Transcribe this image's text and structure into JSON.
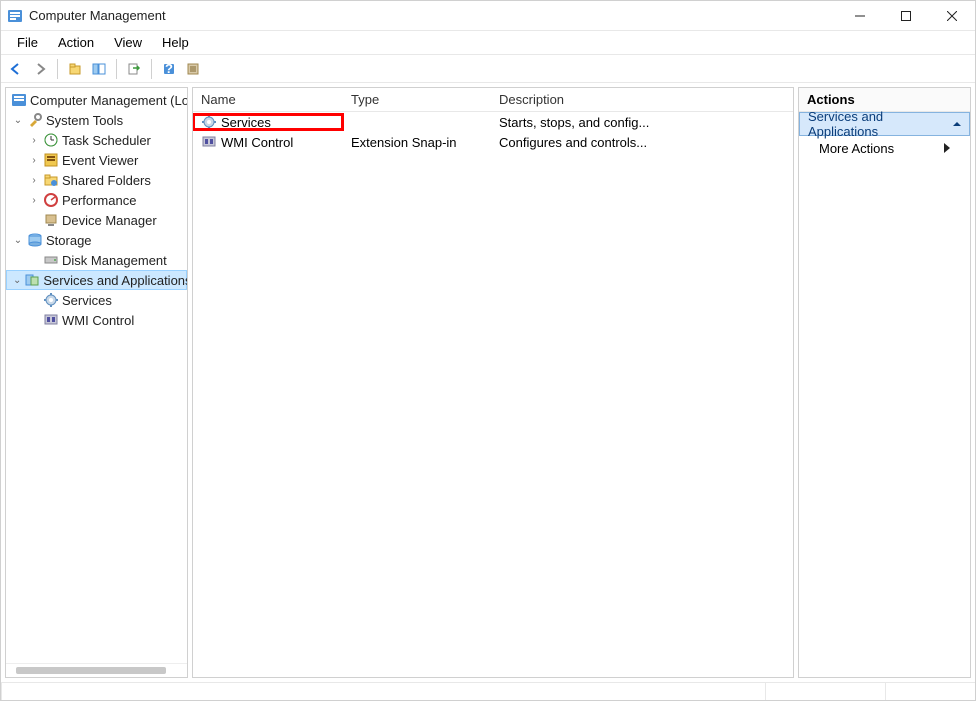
{
  "window": {
    "title": "Computer Management"
  },
  "menu": {
    "file": "File",
    "action": "Action",
    "view": "View",
    "help": "Help"
  },
  "tree": {
    "root": "Computer Management (Local)",
    "system_tools": "System Tools",
    "task_scheduler": "Task Scheduler",
    "event_viewer": "Event Viewer",
    "shared_folders": "Shared Folders",
    "performance": "Performance",
    "device_manager": "Device Manager",
    "storage": "Storage",
    "disk_management": "Disk Management",
    "services_apps": "Services and Applications",
    "services": "Services",
    "wmi_control": "WMI Control"
  },
  "list": {
    "columns": {
      "name": "Name",
      "type": "Type",
      "description": "Description"
    },
    "col_widths": {
      "name": 150,
      "type": 148,
      "description": 200
    },
    "rows": [
      {
        "name": "Services",
        "type": "",
        "description": "Starts, stops, and config..."
      },
      {
        "name": "WMI Control",
        "type": "Extension Snap-in",
        "description": "Configures and controls..."
      }
    ]
  },
  "actions": {
    "header": "Actions",
    "section": "Services and Applications",
    "more_actions": "More Actions"
  }
}
